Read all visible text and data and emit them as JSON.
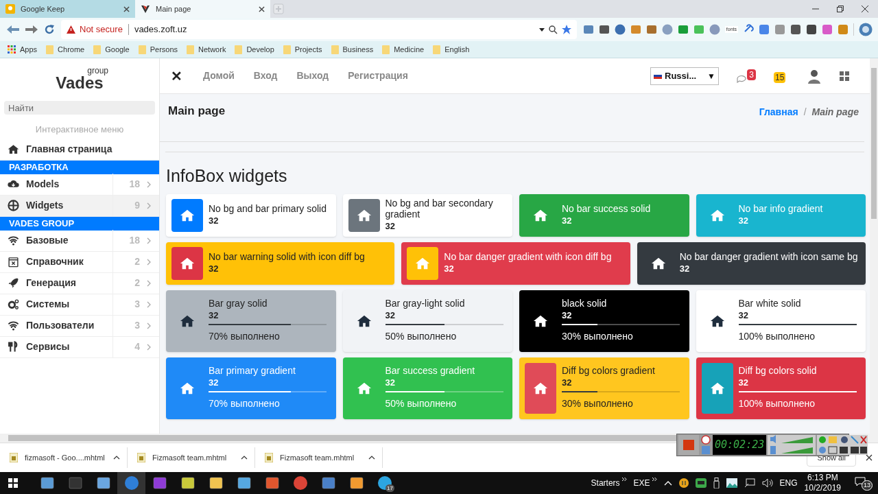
{
  "browser": {
    "tabs": [
      {
        "title": "Google Keep",
        "selected": false
      },
      {
        "title": "Main page",
        "selected": true
      }
    ],
    "address": {
      "warning": "Not secure",
      "url": "vades.zoft.uz"
    },
    "extension_label": "fonts",
    "bookmarks": [
      "Apps",
      "Chrome",
      "Google",
      "Persons",
      "Network",
      "Develop",
      "Projects",
      "Business",
      "Medicine",
      "English"
    ]
  },
  "sidebar": {
    "logo": {
      "word": "Vades",
      "sub": "group"
    },
    "search": {
      "placeholder": "Найти"
    },
    "caption": "Интерактивное меню",
    "items": [
      {
        "kind": "link",
        "label": "Главная страница",
        "selected": false
      },
      {
        "kind": "header",
        "label": "РАЗРАБОТКА"
      },
      {
        "kind": "item",
        "label": "Models",
        "count": "18",
        "selected": false
      },
      {
        "kind": "item",
        "label": "Widgets",
        "count": "9",
        "selected": true
      },
      {
        "kind": "header",
        "label": "VADES GROUP"
      },
      {
        "kind": "item",
        "label": "Базовые",
        "count": "18",
        "selected": false
      },
      {
        "kind": "item",
        "label": "Справочник",
        "count": "2",
        "selected": false
      },
      {
        "kind": "item",
        "label": "Генерация",
        "count": "2",
        "selected": false
      },
      {
        "kind": "item",
        "label": "Системы",
        "count": "3",
        "selected": false
      },
      {
        "kind": "item",
        "label": "Пользователи",
        "count": "3",
        "selected": false
      },
      {
        "kind": "item",
        "label": "Сервисы",
        "count": "4",
        "selected": false
      }
    ]
  },
  "topbar": {
    "close": "✕",
    "links": [
      "Домой",
      "Вход",
      "Выход",
      "Регистрация"
    ],
    "language": {
      "value": "Russi...",
      "caret": "▼"
    },
    "messages_badge": "3",
    "alerts_badge": "15"
  },
  "page": {
    "title": "Main page",
    "breadcrumb": [
      "Главная",
      "Main page"
    ],
    "breadcrumb_separator": "/",
    "section_title": "InfoBox widgets",
    "info_boxes": [
      {
        "title": "No bg and bar primary solid",
        "number": "32",
        "color": "#ffffff",
        "icon": {
          "color": "#007bff"
        },
        "light_text": false,
        "wide": false
      },
      {
        "title": "No bg and bar secondary gradient",
        "number": "32",
        "color": "#ffffff",
        "icon": {
          "color": "#6c757d"
        },
        "light_text": false,
        "wide": false
      },
      {
        "title": "No bar success solid",
        "number": "32",
        "color": "#28a745",
        "light_text": true,
        "wide": false
      },
      {
        "title": "No bar info gradient",
        "number": "32",
        "color": "#19b5cf",
        "light_text": true,
        "wide": false
      },
      {
        "title": "No bar warning solid with icon diff bg",
        "number": "32",
        "color": "#ffc107",
        "icon": {
          "color": "#dc3545"
        },
        "light_text": false,
        "wide": true
      },
      {
        "title": "No bar danger gradient with icon diff bg",
        "number": "32",
        "color": "#e03c4c",
        "icon": {
          "color": "#ffc107"
        },
        "light_text": true,
        "wide": true
      },
      {
        "title": "No bar danger gradient with icon same bg",
        "number": "32",
        "color": "#343a40",
        "light_text": true,
        "wide": true
      },
      {
        "title": "Bar gray solid",
        "number": "32",
        "level": 0.7,
        "progress": "70% выполнено",
        "color": "#adb5bd",
        "light_text": false,
        "wide": false
      },
      {
        "title": "Bar gray-light solid",
        "number": "32",
        "level": 0.5,
        "progress": "50% выполнено",
        "color": "#f1f3f6",
        "light_text": false,
        "wide": false
      },
      {
        "title": "black solid",
        "number": "32",
        "level": 0.3,
        "progress": "30% выполнено",
        "color": "#000000",
        "light_text": true,
        "wide": false
      },
      {
        "title": "Bar white solid",
        "number": "32",
        "level": 1,
        "progress": "100% выполнено",
        "color": "#ffffff",
        "light_text": false,
        "wide": false
      },
      {
        "title": "Bar primary gradient",
        "number": "32",
        "level": 0.7,
        "progress": "70% выполнено",
        "color": "#1f8af7",
        "light_text": true,
        "wide": false
      },
      {
        "title": "Bar success gradient",
        "number": "32",
        "level": 0.5,
        "progress": "50% выполнено",
        "color": "#31c150",
        "light_text": true,
        "wide": false
      },
      {
        "title": "Diff bg colors gradient",
        "number": "32",
        "level": 0.3,
        "progress": "30% выполнено",
        "color": "#ffc61f",
        "icon": {
          "color": "#e04b58"
        },
        "light_text": false,
        "wide": false
      },
      {
        "title": "Diff bg colors solid",
        "number": "32",
        "level": 1,
        "progress": "100% выполнено",
        "color": "#dc3545",
        "icon": {
          "color": "#17a2b8"
        },
        "light_text": true,
        "wide": false
      }
    ]
  },
  "recorder": {
    "timer": "00:02:23"
  },
  "downloads": {
    "files": [
      "fizmasoft - Goo....mhtml",
      "Fizmasoft team.mhtml",
      "Fizmasoft team.mhtml"
    ],
    "show_all": "Show all"
  },
  "taskbar": {
    "telegram_badge": "17",
    "toolbars": [
      "Starters",
      "EXE"
    ],
    "language": "ENG",
    "time": "6:13 PM",
    "date": "10/2/2019",
    "notifications": "13"
  }
}
